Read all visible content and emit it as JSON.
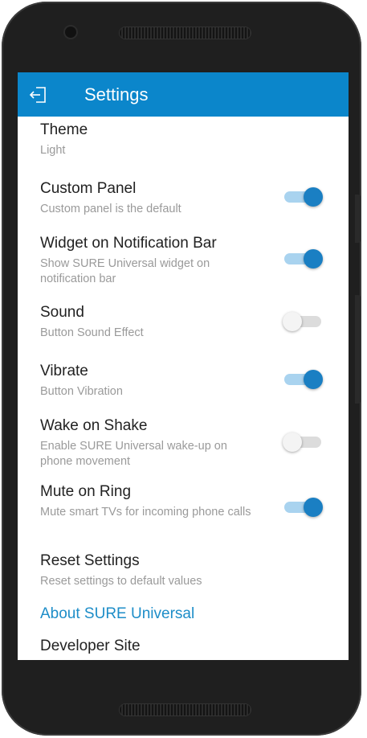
{
  "header": {
    "title": "Settings",
    "back_icon": "exit-back-icon"
  },
  "theme": {
    "title": "Theme",
    "value": "Light"
  },
  "settings": [
    {
      "title": "Custom Panel",
      "subtitle": "Custom panel is the default",
      "enabled": true
    },
    {
      "title": "Widget on Notification Bar",
      "subtitle": "Show SURE Universal widget on notification bar",
      "enabled": true
    },
    {
      "title": "Sound",
      "subtitle": "Button Sound Effect",
      "enabled": false
    },
    {
      "title": "Vibrate",
      "subtitle": "Button Vibration",
      "enabled": true
    },
    {
      "title": "Wake on Shake",
      "subtitle": "Enable SURE Universal wake-up on phone movement",
      "enabled": false
    },
    {
      "title": "Mute on Ring",
      "subtitle": "Mute smart TVs for incoming phone calls",
      "enabled": true
    }
  ],
  "reset": {
    "title": "Reset Settings",
    "subtitle": "Reset settings to default values"
  },
  "about": {
    "label": "About SURE Universal"
  },
  "developer": {
    "title": "Developer Site"
  },
  "colors": {
    "appbar": "#0b86cb",
    "toggle_on_thumb": "#1a7fc3",
    "toggle_on_track": "#a9d3ef",
    "link": "#1d8dc8"
  }
}
